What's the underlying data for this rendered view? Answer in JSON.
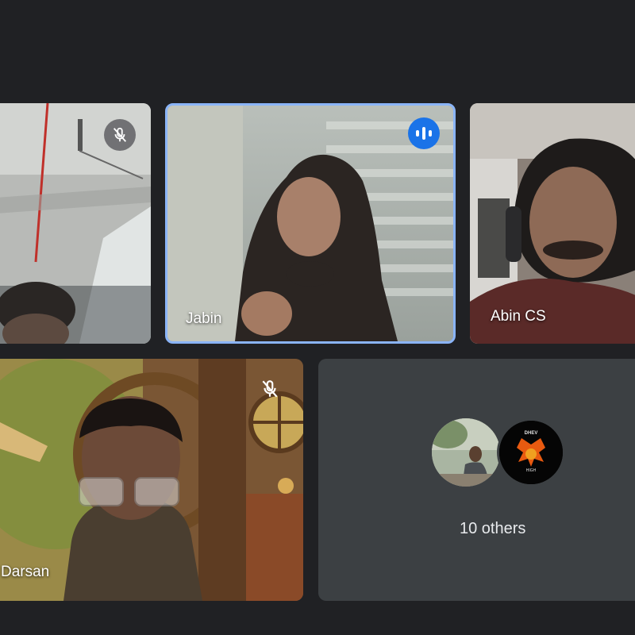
{
  "participants": [
    {
      "name": "",
      "mic": "muted",
      "mic_icon": "mic-off-icon"
    },
    {
      "name": "Jabin",
      "mic": "speaking",
      "mic_icon": "audio-bars-icon",
      "active_speaker": true
    },
    {
      "name": "Abin CS",
      "mic": "on"
    },
    {
      "name": "Darsan",
      "mic": "muted",
      "mic_icon": "mic-off-icon"
    }
  ],
  "others": {
    "label": "10 others",
    "avatars": [
      "participant-photo",
      "dhev-logo"
    ]
  },
  "logo_text": {
    "top": "DHEV",
    "bottom": "HIGH"
  },
  "colors": {
    "background": "#202124",
    "tile": "#3c4043",
    "active_border": "#8ab4f8",
    "speaking_badge": "#1a73e8"
  }
}
